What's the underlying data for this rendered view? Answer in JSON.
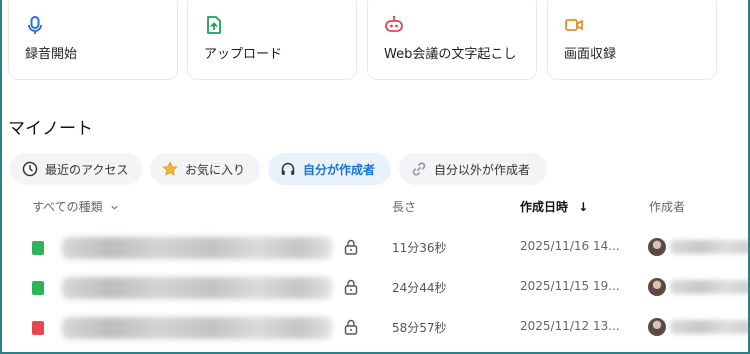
{
  "cards": [
    {
      "label": "録音開始",
      "icon": "microphone-icon",
      "color": "#2a6fdb"
    },
    {
      "label": "アップロード",
      "icon": "upload-icon",
      "color": "#1e9e5a"
    },
    {
      "label": "Web会議の文字起こし",
      "icon": "meeting-bot-icon",
      "color": "#e0445f"
    },
    {
      "label": "画面収録",
      "icon": "screen-record-icon",
      "color": "#f08a24"
    }
  ],
  "section_title": "マイノート",
  "tabs": [
    {
      "label": "最近のアクセス",
      "icon": "clock-icon",
      "active": false
    },
    {
      "label": "お気に入り",
      "icon": "star-icon",
      "active": false
    },
    {
      "label": "自分が作成者",
      "icon": "headphones-icon",
      "active": true
    },
    {
      "label": "自分以外が作成者",
      "icon": "link-icon",
      "active": false
    }
  ],
  "table": {
    "headers": {
      "type": "すべての種類",
      "length": "長さ",
      "created": "作成日時",
      "creator": "作成者"
    },
    "sort_arrow": "↓",
    "rows": [
      {
        "type_color": "#2fb35a",
        "duration": "11分36秒",
        "date": "2025/11/16 14..."
      },
      {
        "type_color": "#2fb35a",
        "duration": "24分44秒",
        "date": "2025/11/15 19..."
      },
      {
        "type_color": "#e8454f",
        "duration": "58分57秒",
        "date": "2025/11/12 13..."
      }
    ]
  },
  "colors": {
    "accent": "#1a73d9",
    "frame": "#2f7f86"
  }
}
